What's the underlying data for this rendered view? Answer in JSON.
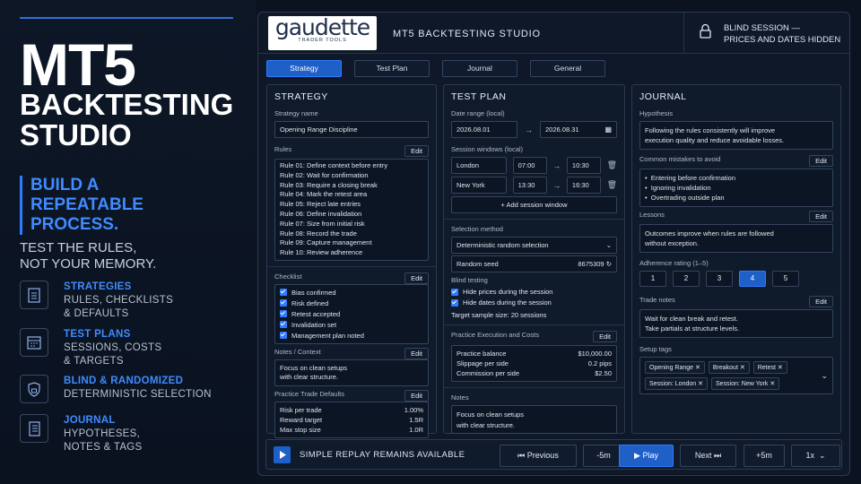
{
  "left": {
    "title": "MT5",
    "subtitle": "BACKTESTING STUDIO",
    "build": "BUILD A REPEATABLE PROCESS.",
    "test1": "TEST THE RULES,",
    "test2": "NOT YOUR MEMORY.",
    "features": [
      {
        "h": "STRATEGIES",
        "l1": "RULES, CHECKLISTS",
        "l2": "& DEFAULTS"
      },
      {
        "h": "TEST PLANS",
        "l1": "SESSIONS, COSTS",
        "l2": "& TARGETS"
      },
      {
        "h": "BLIND & RANDOMIZED",
        "l1": "DETERMINISTIC SELECTION",
        "l2": ""
      },
      {
        "h": "JOURNAL",
        "l1": "HYPOTHESES,",
        "l2": "NOTES & TAGS"
      }
    ]
  },
  "header": {
    "logo": "gaudette",
    "logo_sub": "TRADER TOOLS",
    "title": "MT5 BACKTESTING STUDIO",
    "blind1": "BLIND SESSION —",
    "blind2": "PRICES AND DATES HIDDEN"
  },
  "tabs": [
    "Strategy",
    "Test Plan",
    "Journal",
    "General"
  ],
  "strategy": {
    "title": "STRATEGY",
    "name_label": "Strategy name",
    "name_value": "Opening Range Discipline",
    "rules_label": "Rules",
    "edit": "Edit",
    "rules": [
      "Rule 01:  Define context before entry",
      "Rule 02:  Wait for confirmation",
      "Rule 03:  Require a closing break",
      "Rule 04:  Mark the retest area",
      "Rule 05:  Reject late entries",
      "Rule 06:  Define invalidation",
      "Rule 07:  Size from initial risk",
      "Rule 08:  Record the trade",
      "Rule 09:  Capture management",
      "Rule 10:  Review adherence"
    ],
    "checklist_label": "Checklist",
    "checklist": [
      "Bias confirmed",
      "Risk defined",
      "Retest accepted",
      "Invalidation set",
      "Management plan noted"
    ],
    "notes_label": "Notes / Context",
    "notes1": "Focus on clean setups",
    "notes2": "with clear structure.",
    "defaults_label": "Practice Trade Defaults",
    "defaults": [
      {
        "k": "Risk per trade",
        "v": "1.00%"
      },
      {
        "k": "Reward target",
        "v": "1.5R"
      },
      {
        "k": "Max stop size",
        "v": "1.0R"
      }
    ]
  },
  "plan": {
    "title": "TEST PLAN",
    "date_label": "Date range (local)",
    "date_from": "2026.08.01",
    "date_to": "2026.08.31",
    "sessions_label": "Session windows (local)",
    "sessions": [
      {
        "name": "London",
        "from": "07:00",
        "to": "10:30"
      },
      {
        "name": "New York",
        "from": "13:30",
        "to": "16:30"
      }
    ],
    "add_session": "+ Add session window",
    "selection_label": "Selection method",
    "selection": "Deterministic random selection",
    "seed_label": "Random seed",
    "seed": "8675309",
    "blind_label": "Blind testing",
    "hide_prices": "Hide prices during the session",
    "hide_dates": "Hide dates during the session",
    "target": "Target sample size: 20 sessions",
    "costs_label": "Practice Execution and Costs",
    "edit": "Edit",
    "costs": [
      {
        "k": "Practice balance",
        "v": "$10,000.00"
      },
      {
        "k": "Slippage per side",
        "v": "0.2 pips"
      },
      {
        "k": "Commission per side",
        "v": "$2.50"
      }
    ],
    "notes_label": "Notes",
    "notes1": "Focus on clean setups",
    "notes2": "with clear structure."
  },
  "journal": {
    "title": "JOURNAL",
    "hyp_label": "Hypothesis",
    "hyp1": "Following the rules consistently will improve",
    "hyp2": "execution quality and reduce avoidable losses.",
    "mistakes_label": "Common mistakes to avoid",
    "edit": "Edit",
    "mistakes": [
      "Entering before confirmation",
      "Ignoring invalidation",
      "Overtrading outside plan"
    ],
    "lessons_label": "Lessons",
    "lessons1": "Outcomes improve when rules are followed",
    "lessons2": "without exception.",
    "rating_label": "Adherence rating (1–5)",
    "ratings": [
      "1",
      "2",
      "3",
      "4",
      "5"
    ],
    "rating_selected": 4,
    "trade_label": "Trade notes",
    "trade1": "Wait for clean break and retest.",
    "trade2": "Take partials at structure levels.",
    "tags_label": "Setup tags",
    "tags": [
      "Opening Range",
      "Breakout",
      "Retest",
      "Session: London",
      "Session: New York"
    ]
  },
  "bottom": {
    "replay": "SIMPLE REPLAY REMAINS AVAILABLE",
    "previous": "Previous",
    "minus5": "-5m",
    "play": "Play",
    "next": "Next",
    "plus5": "+5m",
    "speed": "1x"
  }
}
